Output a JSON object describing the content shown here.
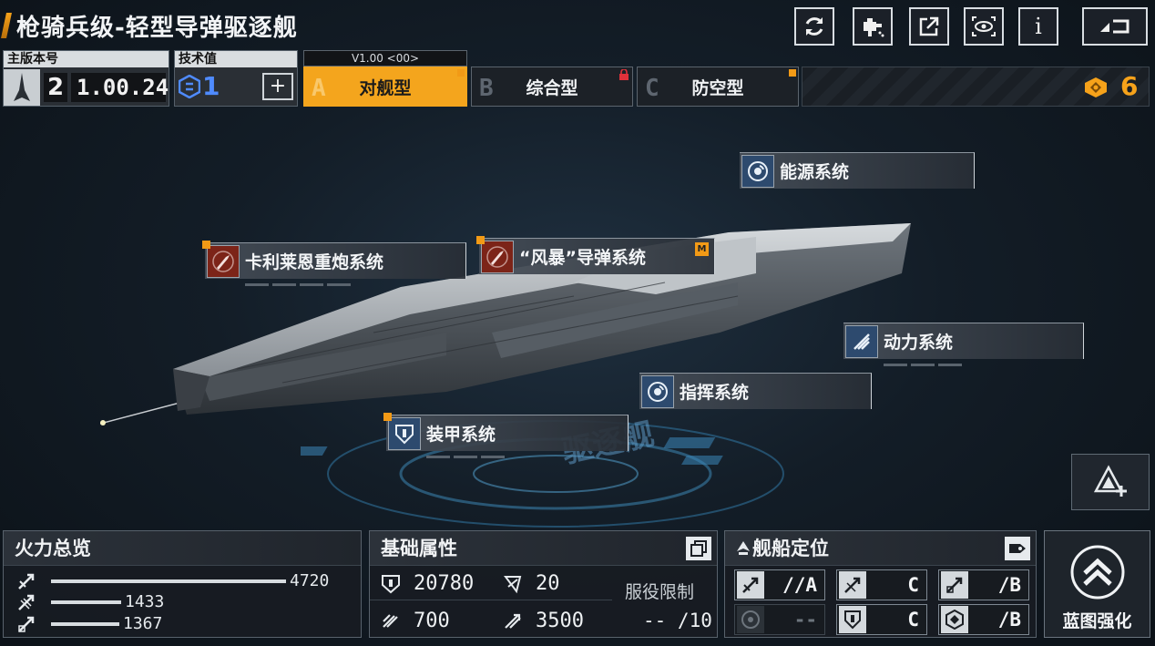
{
  "title": "枪骑兵级-轻型导弹驱逐舰",
  "toolbar": {
    "buttons": [
      "refresh-icon",
      "paint-icon",
      "share-icon",
      "view-icon",
      "info-icon",
      "back-icon"
    ],
    "info_label": "i"
  },
  "version": {
    "label": "主版本号",
    "major": "2",
    "minor": "1.00.24"
  },
  "tech": {
    "label": "技术值",
    "value": "1",
    "plus": "+"
  },
  "tabs": [
    {
      "letter": "A",
      "label": "对舰型",
      "version": "V1.00 <00>",
      "active": true
    },
    {
      "letter": "B",
      "label": "综合型",
      "locked": true
    },
    {
      "letter": "C",
      "label": "防空型"
    }
  ],
  "currency": {
    "value": "6",
    "icon": "gear-coin-icon",
    "color": "#f6a21a"
  },
  "ship_floor_text": "驱逐舰",
  "systems": {
    "energy": "能源系统",
    "cannon": "卡利莱恩重炮系统",
    "missile": "“风暴”导弹系统",
    "missile_badge": "M",
    "power": "动力系统",
    "command": "指挥系统",
    "armor": "装甲系统"
  },
  "firepower": {
    "title": "火力总览",
    "rows": [
      {
        "icon": "anti-ship-icon",
        "value": "4720",
        "ratio": 1.0
      },
      {
        "icon": "anti-air-icon",
        "value": "1433",
        "ratio": 0.3
      },
      {
        "icon": "siege-icon",
        "value": "1367",
        "ratio": 0.29
      }
    ]
  },
  "base_stats": {
    "title": "基础属性",
    "hp": "20780",
    "armor": "20",
    "shield": "700",
    "speed": "3500",
    "service_label": "服役限制",
    "service_value": "-- /10"
  },
  "positioning": {
    "title": "舰船定位",
    "cells": [
      {
        "icon": "anti-ship-icon",
        "value": "//A"
      },
      {
        "icon": "anti-air-icon",
        "value": "C"
      },
      {
        "icon": "siege-icon",
        "value": "/B"
      },
      {
        "icon": "target-icon",
        "value": "--",
        "dim": true
      },
      {
        "icon": "shield-icon",
        "value": "C"
      },
      {
        "icon": "support-icon",
        "value": "/B"
      }
    ]
  },
  "upgrade": {
    "label": "蓝图强化"
  },
  "colors": {
    "accent": "#f4a51d",
    "tech_blue": "#4f8bff",
    "danger": "#7c2418"
  }
}
